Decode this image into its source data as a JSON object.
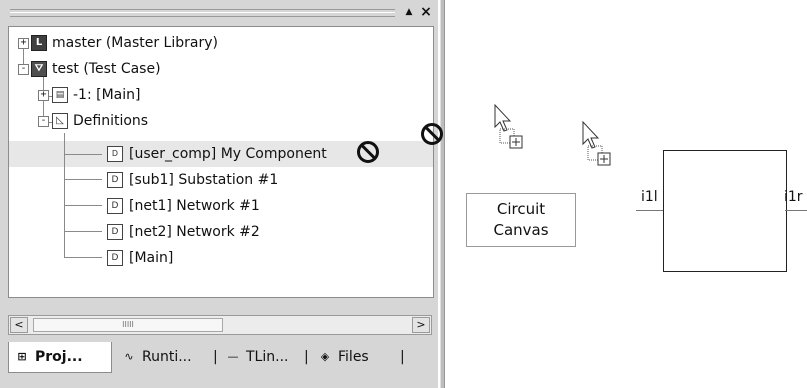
{
  "tree": {
    "items": [
      {
        "label": "master (Master Library)",
        "expander": "+",
        "icon": "library-L-icon",
        "glyph": "L"
      },
      {
        "label": "test (Test Case)",
        "expander": "-",
        "icon": "test-case-icon",
        "glyph": "⛛"
      },
      {
        "label": "-1: [Main]",
        "expander": "+",
        "icon": "page-icon",
        "glyph": "▤"
      },
      {
        "label": "Definitions",
        "expander": "-",
        "icon": "definitions-icon",
        "glyph": "◺"
      },
      {
        "label": "[user_comp] My Component",
        "icon": "component-icon",
        "glyph": "D"
      },
      {
        "label": "[sub1] Substation #1",
        "icon": "page-icon",
        "glyph": "D"
      },
      {
        "label": "[net1] Network #1",
        "icon": "page-icon",
        "glyph": "D"
      },
      {
        "label": "[net2] Network #2",
        "icon": "page-icon",
        "glyph": "D"
      },
      {
        "label": "[Main]",
        "icon": "page-icon",
        "glyph": "D"
      }
    ]
  },
  "header": {
    "pin_glyph": "▲",
    "close_glyph": "×"
  },
  "scroll": {
    "left": "<",
    "right": ">",
    "thumb": "IIIII"
  },
  "tabs": [
    {
      "label": "Proj...",
      "icon": "project-icon",
      "glyph": "⊞"
    },
    {
      "label": "Runti...",
      "icon": "runtime-wave-icon",
      "glyph": "∿"
    },
    {
      "label": "TLin...",
      "icon": "tline-icon",
      "glyph": "—"
    },
    {
      "label": "Files",
      "icon": "files-icon",
      "glyph": "◈"
    }
  ],
  "tab_separator": "|",
  "canvas": {
    "label_line1": "Circuit",
    "label_line2": "Canvas",
    "port_left": "i1l",
    "port_right": "i1r"
  }
}
